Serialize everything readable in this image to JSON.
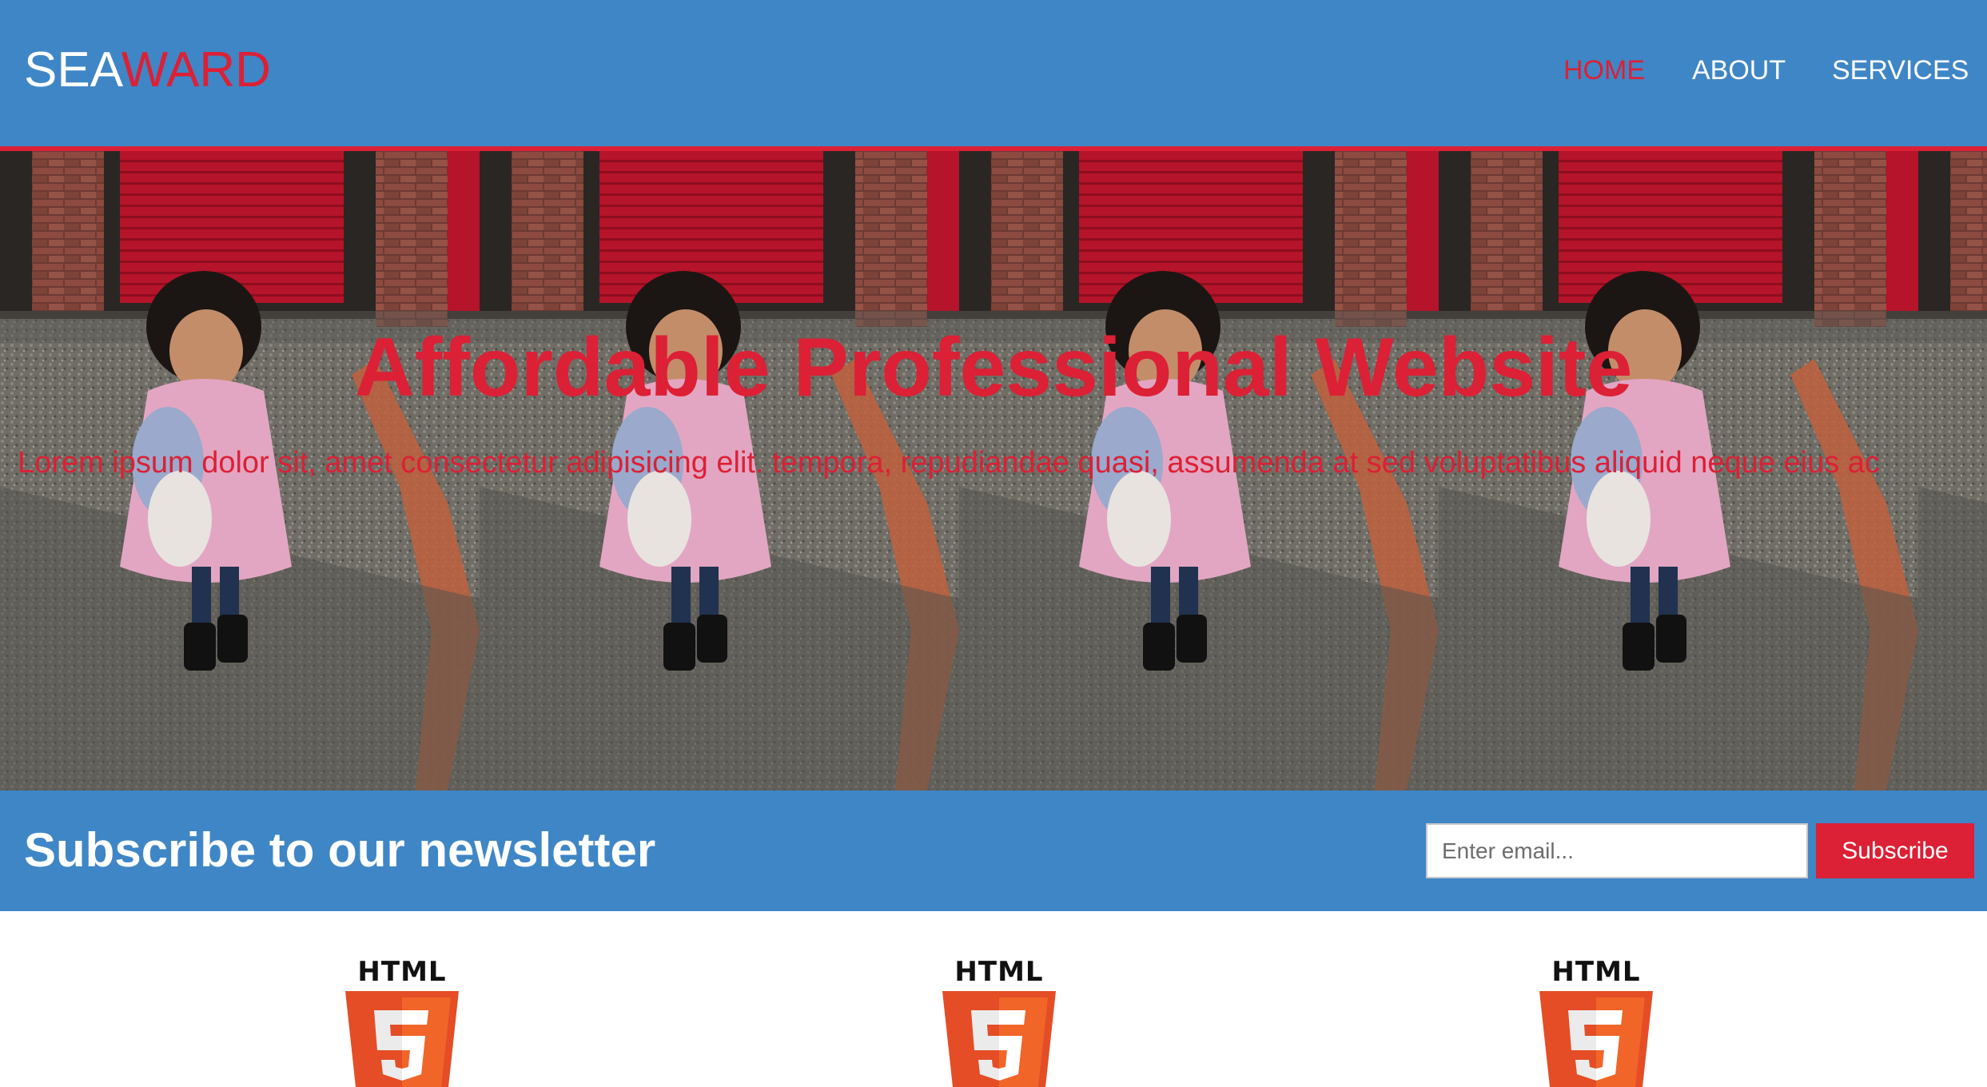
{
  "header": {
    "brand_part1": "SEA",
    "brand_part2": "WARD",
    "nav": [
      {
        "label": "HOME",
        "active": true
      },
      {
        "label": "ABOUT",
        "active": false
      },
      {
        "label": "SERVICES",
        "active": false
      }
    ]
  },
  "hero": {
    "title": "Affordable Professional Website",
    "text": "Lorem ipsum dolor sit, amet consectetur adipisicing elit. tempora, repudiandae quasi, assumenda at sed voluptatibus aliquid neque eius ac"
  },
  "newsletter": {
    "title": "Subscribe to our newsletter",
    "email_placeholder": "Enter email...",
    "button_label": "Subscribe"
  },
  "features": [
    {
      "logo_text": "HTML",
      "icon": "html5-logo-icon"
    },
    {
      "logo_text": "HTML",
      "icon": "html5-logo-icon"
    },
    {
      "logo_text": "HTML",
      "icon": "html5-logo-icon"
    }
  ],
  "colors": {
    "header_bg": "#3f86c6",
    "accent": "#dc2035",
    "white": "#ffffff"
  }
}
